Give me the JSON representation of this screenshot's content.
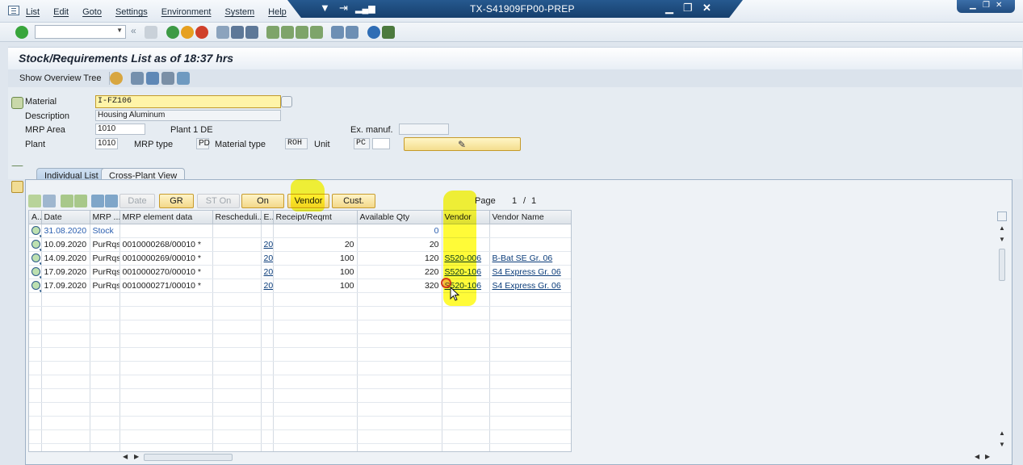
{
  "menu": {
    "items": [
      "List",
      "Edit",
      "Goto",
      "Settings",
      "Environment",
      "System",
      "Help"
    ]
  },
  "window": {
    "system_title": "TX-S41909FP00-PREP"
  },
  "page": {
    "title": "Stock/Requirements List as of 18:37 hrs"
  },
  "app_toolbar": {
    "show_overview_tree": "Show Overview Tree"
  },
  "header": {
    "material_label": "Material",
    "material_value": "I-FZ106",
    "description_label": "Description",
    "description_value": "Housing Aluminum",
    "mrp_area_label": "MRP Area",
    "mrp_area_value": "1010",
    "mrp_area_text": "Plant 1 DE",
    "plant_label": "Plant",
    "plant_value": "1010",
    "mrp_type_label": "MRP type",
    "mrp_type_value": "PD",
    "material_type_label": "Material type",
    "material_type_value": "ROH",
    "unit_label": "Unit",
    "unit_value": "PC",
    "ex_manuf_label": "Ex. manuf."
  },
  "tabs": [
    {
      "label": "Individual List",
      "active": true
    },
    {
      "label": "Cross-Plant View",
      "active": false
    }
  ],
  "grid_toolbar": {
    "date_btn": "Date",
    "gr_btn": "GR",
    "st_on_btn": "ST On",
    "on_btn": "On",
    "vendor_btn": "Vendor",
    "cust_btn": "Cust.",
    "page_label": "Page",
    "page_current": "1",
    "page_sep": "/",
    "page_total": "1"
  },
  "grid": {
    "columns": [
      "A..",
      "Date",
      "MRP ...",
      "MRP element data",
      "Rescheduli...",
      "E..",
      "Receipt/Reqmt",
      "Available Qty",
      "Vendor",
      "Vendor Name"
    ],
    "rows": [
      {
        "date": "31.08.2020",
        "mrp": "Stock",
        "element": "",
        "resched": "",
        "e": "",
        "receipt": "",
        "available": "0",
        "vendor": "",
        "vendor_name": ""
      },
      {
        "date": "10.09.2020",
        "mrp": "PurRqs",
        "element": "0010000268/00010 *",
        "resched": "",
        "e": "20",
        "receipt": "20",
        "available": "20",
        "vendor": "",
        "vendor_name": ""
      },
      {
        "date": "14.09.2020",
        "mrp": "PurRqs",
        "element": "0010000269/00010 *",
        "resched": "",
        "e": "20",
        "receipt": "100",
        "available": "120",
        "vendor": "S520-006",
        "vendor_name": "B-Bat SE Gr. 06"
      },
      {
        "date": "17.09.2020",
        "mrp": "PurRqs",
        "element": "0010000270/00010 *",
        "resched": "",
        "e": "20",
        "receipt": "100",
        "available": "220",
        "vendor": "S520-106",
        "vendor_name": "S4 Express Gr. 06"
      },
      {
        "date": "17.09.2020",
        "mrp": "PurRqs",
        "element": "0010000271/00010 *",
        "resched": "",
        "e": "20",
        "receipt": "100",
        "available": "320",
        "vendor": "S520-106",
        "vendor_name": "S4 Express Gr. 06"
      }
    ]
  },
  "colors": {
    "title_bar": "#1e4f86",
    "highlight": "#fff200",
    "button_yellow": "#f3d889"
  }
}
